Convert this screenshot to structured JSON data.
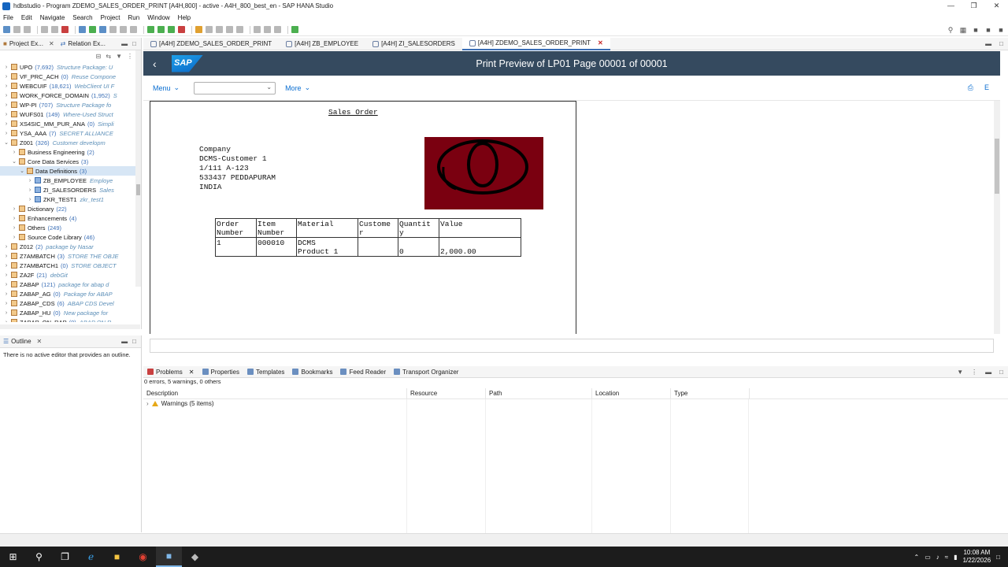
{
  "window": {
    "title": "hdbstudio - Program ZDEMO_SALES_ORDER_PRINT [A4H,800] - active - A4H_800_best_en - SAP HANA Studio"
  },
  "menubar": [
    "File",
    "Edit",
    "Navigate",
    "Search",
    "Project",
    "Run",
    "Window",
    "Help"
  ],
  "left_panel": {
    "tabs": [
      {
        "label": "Project Ex..."
      },
      {
        "label": "Relation Ex..."
      }
    ],
    "tree": [
      {
        "name": "UPO",
        "count": "(7,692)",
        "desc": "Structure Package: U",
        "level": 1
      },
      {
        "name": "VF_PRC_ACH",
        "count": "(0)",
        "desc": "Reuse Compone",
        "level": 1
      },
      {
        "name": "WEBCUIF",
        "count": "(18,621)",
        "desc": "WebClient UI F",
        "level": 1
      },
      {
        "name": "WORK_FORCE_DOMAIN",
        "count": "(1,952)",
        "desc": "S",
        "level": 1
      },
      {
        "name": "WP-PI",
        "count": "(707)",
        "desc": "Structure Package fo",
        "level": 1
      },
      {
        "name": "WUFS01",
        "count": "(149)",
        "desc": "Where-Used Struct",
        "level": 1
      },
      {
        "name": "XS4SIC_MM_PUR_ANA",
        "count": "(0)",
        "desc": "Simpli",
        "level": 1
      },
      {
        "name": "YSA_AAA",
        "count": "(7)",
        "desc": "SECRET ALLIANCE",
        "level": 1
      },
      {
        "name": "Z001",
        "count": "(326)",
        "desc": "Customer developm",
        "level": 1,
        "open": true
      },
      {
        "name": "Business Engineering",
        "count": "(2)",
        "desc": "",
        "level": 2
      },
      {
        "name": "Core Data Services",
        "count": "(3)",
        "desc": "",
        "level": 2,
        "open": true
      },
      {
        "name": "Data Definitions",
        "count": "(3)",
        "desc": "",
        "level": 3,
        "open": true,
        "selected": true
      },
      {
        "name": "ZB_EMPLOYEE",
        "count": "",
        "desc": "Employe",
        "level": 4,
        "dd": true
      },
      {
        "name": "ZI_SALESORDERS",
        "count": "",
        "desc": "Sales",
        "level": 4,
        "dd": true
      },
      {
        "name": "ZKR_TEST1",
        "count": "",
        "desc": "zkr_test1",
        "level": 4,
        "dd": true
      },
      {
        "name": "Dictionary",
        "count": "(22)",
        "desc": "",
        "level": 2
      },
      {
        "name": "Enhancements",
        "count": "(4)",
        "desc": "",
        "level": 2
      },
      {
        "name": "Others",
        "count": "(249)",
        "desc": "",
        "level": 2
      },
      {
        "name": "Source Code Library",
        "count": "(46)",
        "desc": "",
        "level": 2
      },
      {
        "name": "Z012",
        "count": "(2)",
        "desc": "package by Nasar",
        "level": 1
      },
      {
        "name": "Z7AMBATCH",
        "count": "(3)",
        "desc": "STORE THE OBJE",
        "level": 1
      },
      {
        "name": "Z7AMBATCH1",
        "count": "(0)",
        "desc": "STORE OBJECT",
        "level": 1
      },
      {
        "name": "ZA2F",
        "count": "(21)",
        "desc": "debGit",
        "level": 1
      },
      {
        "name": "ZABAP",
        "count": "(121)",
        "desc": "package for abap d",
        "level": 1
      },
      {
        "name": "ZABAP_AG",
        "count": "(0)",
        "desc": "Package for ABAP",
        "level": 1
      },
      {
        "name": "ZABAP_CDS",
        "count": "(6)",
        "desc": "ABAP CDS Devel",
        "level": 1
      },
      {
        "name": "ZABAP_HU",
        "count": "(0)",
        "desc": "New package for",
        "level": 1
      },
      {
        "name": "ZABAP_ON_RAP",
        "count": "(0)",
        "desc": "ABAP ON R",
        "level": 1
      }
    ]
  },
  "outline": {
    "tab": "Outline",
    "message": "There is no active editor that provides an outline."
  },
  "editor_tabs": [
    {
      "label": "[A4H] ZDEMO_SALES_ORDER_PRINT",
      "active": false
    },
    {
      "label": "[A4H] ZB_EMPLOYEE",
      "active": false
    },
    {
      "label": "[A4H] ZI_SALESORDERS",
      "active": false
    },
    {
      "label": "[A4H] ZDEMO_SALES_ORDER_PRINT",
      "active": true
    }
  ],
  "sap": {
    "logo": "SAP",
    "title": "Print Preview of LP01 Page 00001 of 00001",
    "menu_label": "Menu",
    "more_label": "More",
    "right_label": "E"
  },
  "document": {
    "heading": "Sales Order",
    "address": [
      "Company",
      "DCMS-Customer 1",
      "1/111 A-123",
      "533437 PEDDAPURAM",
      "INDIA"
    ],
    "table": {
      "headers": [
        [
          "Order",
          "Number"
        ],
        [
          "Item",
          "Number"
        ],
        [
          "Material",
          ""
        ],
        [
          "Custome",
          "r"
        ],
        [
          "Quantit",
          "y"
        ],
        [
          "Value",
          ""
        ]
      ],
      "row": [
        [
          "1",
          ""
        ],
        [
          "000010",
          ""
        ],
        [
          "DCMS",
          "Product 1"
        ],
        [
          "",
          ""
        ],
        [
          "",
          "0"
        ],
        [
          "",
          "2,000.00"
        ]
      ]
    }
  },
  "problems": {
    "tabs": [
      "Problems",
      "Properties",
      "Templates",
      "Bookmarks",
      "Feed Reader",
      "Transport Organizer"
    ],
    "summary": "0 errors, 5 warnings, 0 others",
    "columns": [
      "Description",
      "Resource",
      "Path",
      "Location",
      "Type"
    ],
    "warning_row": "Warnings (5 items)"
  },
  "taskbar": {
    "time": "10:08 AM",
    "date": "1/22/2026"
  }
}
